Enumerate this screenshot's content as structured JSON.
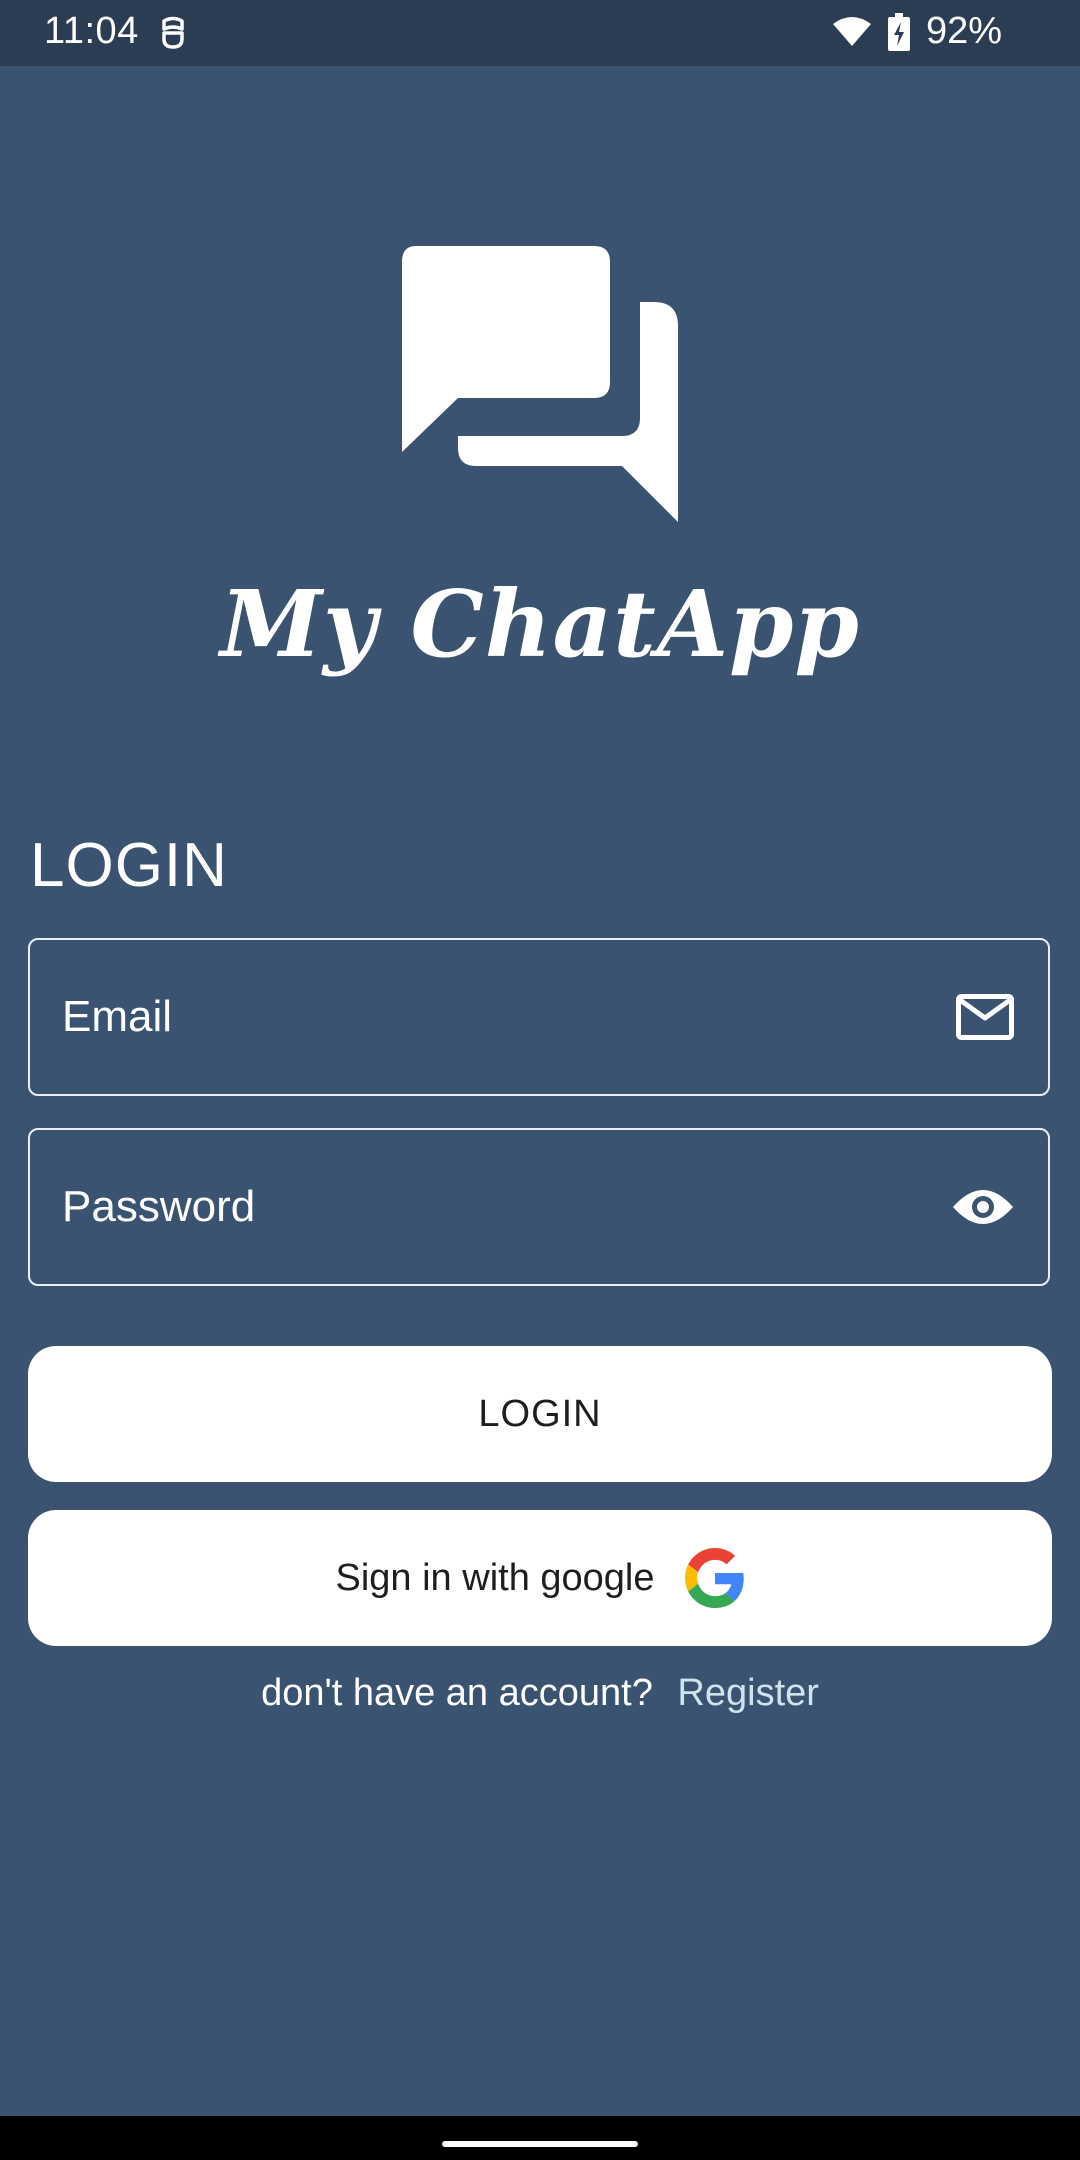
{
  "status_bar": {
    "time": "11:04",
    "battery": "92%",
    "left_icon": "notification-icon",
    "wifi_icon": "wifi-icon",
    "battery_icon": "battery-charging-icon"
  },
  "logo": {
    "icon": "chat-bubbles-icon",
    "app_name": "My ChatApp"
  },
  "login": {
    "title": "LOGIN",
    "email_placeholder": "Email",
    "email_icon": "mail-icon",
    "password_placeholder": "Password",
    "password_icon": "eye-icon",
    "login_button": "LOGIN",
    "google_button": "Sign in with google",
    "google_icon": "google-icon",
    "register_prompt": "don't have an account?",
    "register_link": "Register"
  },
  "colors": {
    "background": "#3a5370",
    "status_bar": "#2b3d52",
    "button_bg": "#ffffff",
    "link": "#cfe3ee"
  }
}
